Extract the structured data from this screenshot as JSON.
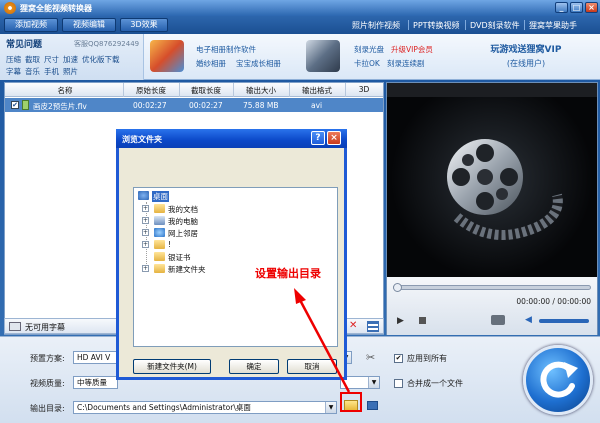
{
  "window": {
    "title": "狸窝全能视频转换器",
    "minimize": "_",
    "maximize": "□",
    "close": "×"
  },
  "toolbar": {
    "add_video": "添加视频",
    "video_edit": "视频编辑",
    "effect_3d": "3D效果",
    "links": [
      "照片制作视频",
      "PPT转换视频",
      "DVD刻录软件",
      "狸窝苹果助手"
    ]
  },
  "faq": {
    "title": "常见问题",
    "qq": "客服QQ876292449",
    "row1": [
      "压缩",
      "截取",
      "尺寸",
      "加速",
      "优化版下载"
    ],
    "row2": [
      "字幕",
      "音乐",
      "手机",
      "照片"
    ]
  },
  "promo": {
    "link1": "电子相册制作软件",
    "link2": "婚纱相册",
    "link3": "宝宝成长相册",
    "link4": "刻录光盘",
    "link5": "升级VIP会员",
    "link6": "卡拉OK",
    "link7": "刻录连续剧",
    "vip_title": "玩游戏送狸窝VIP",
    "vip_sub": "(在线用户)"
  },
  "file_table": {
    "columns": [
      "名称",
      "原始长度",
      "截取长度",
      "输出大小",
      "输出格式",
      "3D"
    ],
    "rows": [
      {
        "name": "画皮2预告片.flv",
        "original": "00:02:27",
        "clip": "00:02:27",
        "size": "75.88 MB",
        "format": "avi",
        "checked": "✔"
      }
    ]
  },
  "subtitle": {
    "label": "无可用字幕"
  },
  "player": {
    "time": "00:00:00 / 00:00:00"
  },
  "settings": {
    "preset_label": "预置方案:",
    "preset_value": "HD AVI V",
    "quality_label": "视频质量:",
    "quality_value": "中等质量",
    "output_label": "输出目录:",
    "output_value": "C:\\Documents and Settings\\Administrator\\桌面",
    "apply_all": "应用到所有",
    "apply_all_checked": "✔",
    "merge": "合并成一个文件"
  },
  "dialog": {
    "title": "浏览文件夹",
    "help": "?",
    "close": "×",
    "tree": [
      {
        "label": "桌面",
        "selected": true
      },
      {
        "label": "我的文档",
        "toggle": "+"
      },
      {
        "label": "我的电脑",
        "toggle": "+"
      },
      {
        "label": "网上邻居",
        "toggle": "+"
      },
      {
        "label": "!",
        "toggle": "+"
      },
      {
        "label": "银证书"
      },
      {
        "label": "新建文件夹",
        "toggle": "+"
      }
    ],
    "new_folder": "新建文件夹(M)",
    "ok": "确定",
    "cancel": "取消"
  },
  "annotation": {
    "text": "设置输出目录"
  },
  "colors": {
    "accent": "#1d57a0",
    "annotation": "#e00000",
    "selection": "#4f86c8"
  }
}
